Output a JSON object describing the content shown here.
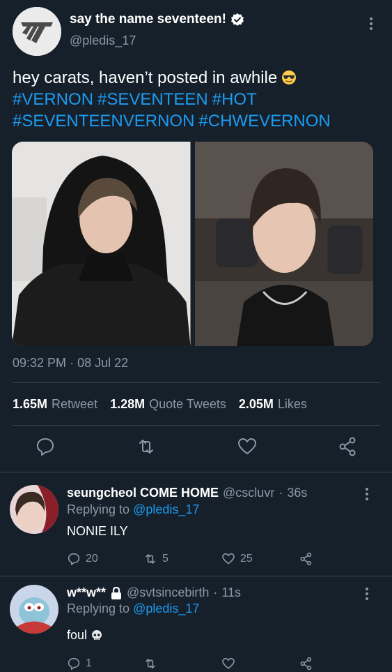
{
  "tweet": {
    "display_name": "say the name seventeen!",
    "handle": "@pledis_17",
    "text": "hey carats, haven’t posted in awhile",
    "hashtags": [
      "#VERNON",
      "#SEVENTEEN",
      "#HOT",
      "#SEVENTEENVERNON",
      "#CHWEVERNON"
    ],
    "time": "09:32 PM",
    "date": "08 Jul 22",
    "retweets": "1.65M",
    "retweets_label": "Retweet",
    "quotes": "1.28M",
    "quotes_label": "Quote Tweets",
    "likes": "2.05M",
    "likes_label": "Likes"
  },
  "replies": [
    {
      "name": "seungcheol COME HOME",
      "handle": "@cscluvr",
      "age": "36s",
      "replying_to_label": "Replying to",
      "replying_to": "@pledis_17",
      "text": "NONIE ILY",
      "replies_count": "20",
      "retweets_count": "5",
      "likes_count": "25"
    },
    {
      "name": "w**w**",
      "handle": "@svtsincebirth",
      "age": "11s",
      "replying_to_label": "Replying to",
      "replying_to": "@pledis_17",
      "text": "foul",
      "replies_count": "1",
      "retweets_count": "",
      "likes_count": ""
    }
  ],
  "colors": {
    "background": "#15202b",
    "link": "#1d9bf0",
    "muted": "#8b98a5",
    "divider": "#38444d"
  },
  "icons": [
    "seventeen-logo",
    "verified-badge",
    "sunglasses-emoji",
    "reply",
    "retweet",
    "like",
    "share",
    "more",
    "lock",
    "skull-emoji"
  ]
}
